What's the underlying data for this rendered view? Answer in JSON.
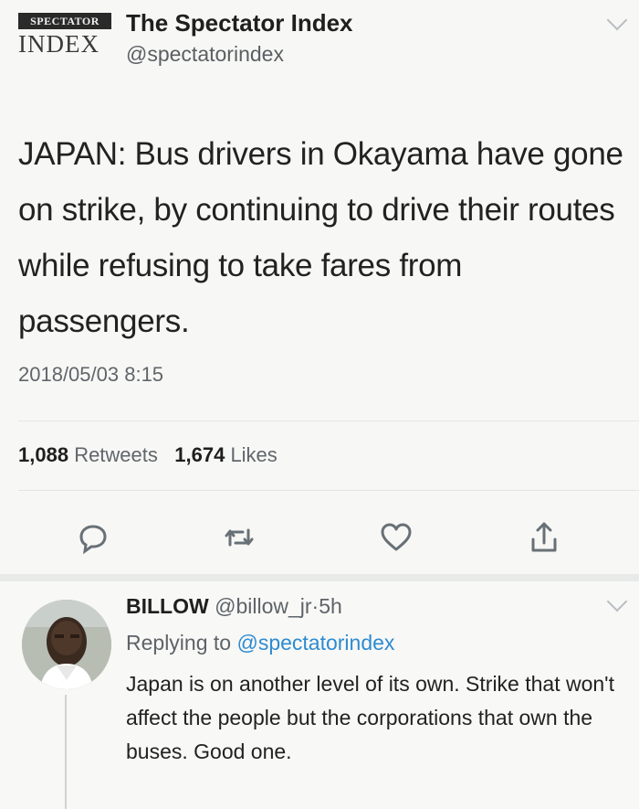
{
  "tweet": {
    "logo": {
      "top": "SPECTATOR",
      "bottom": "INDEX"
    },
    "author_name": "The Spectator Index",
    "author_handle": "@spectatorindex",
    "text": "JAPAN: Bus drivers in Okayama  have gone on strike, by continuing to drive their routes while refusing to take fares from passengers.",
    "timestamp": "2018/05/03 8:15",
    "retweets_count": "1,088",
    "retweets_label": "Retweets",
    "likes_count": "1,674",
    "likes_label": "Likes",
    "icons": [
      "reply-icon",
      "retweet-icon",
      "like-icon",
      "share-icon"
    ]
  },
  "reply": {
    "name": "BILLOW",
    "handle": "@billow_jr",
    "separator": "·",
    "age": "5h",
    "replying_prefix": "Replying to",
    "replying_to": "@spectatorindex",
    "text": "Japan is on another level of its own. Strike that won't affect the people but the corporations that own the buses. Good one."
  },
  "colors": {
    "link": "#2e8bd1",
    "muted": "#60666b",
    "text": "#222222"
  }
}
